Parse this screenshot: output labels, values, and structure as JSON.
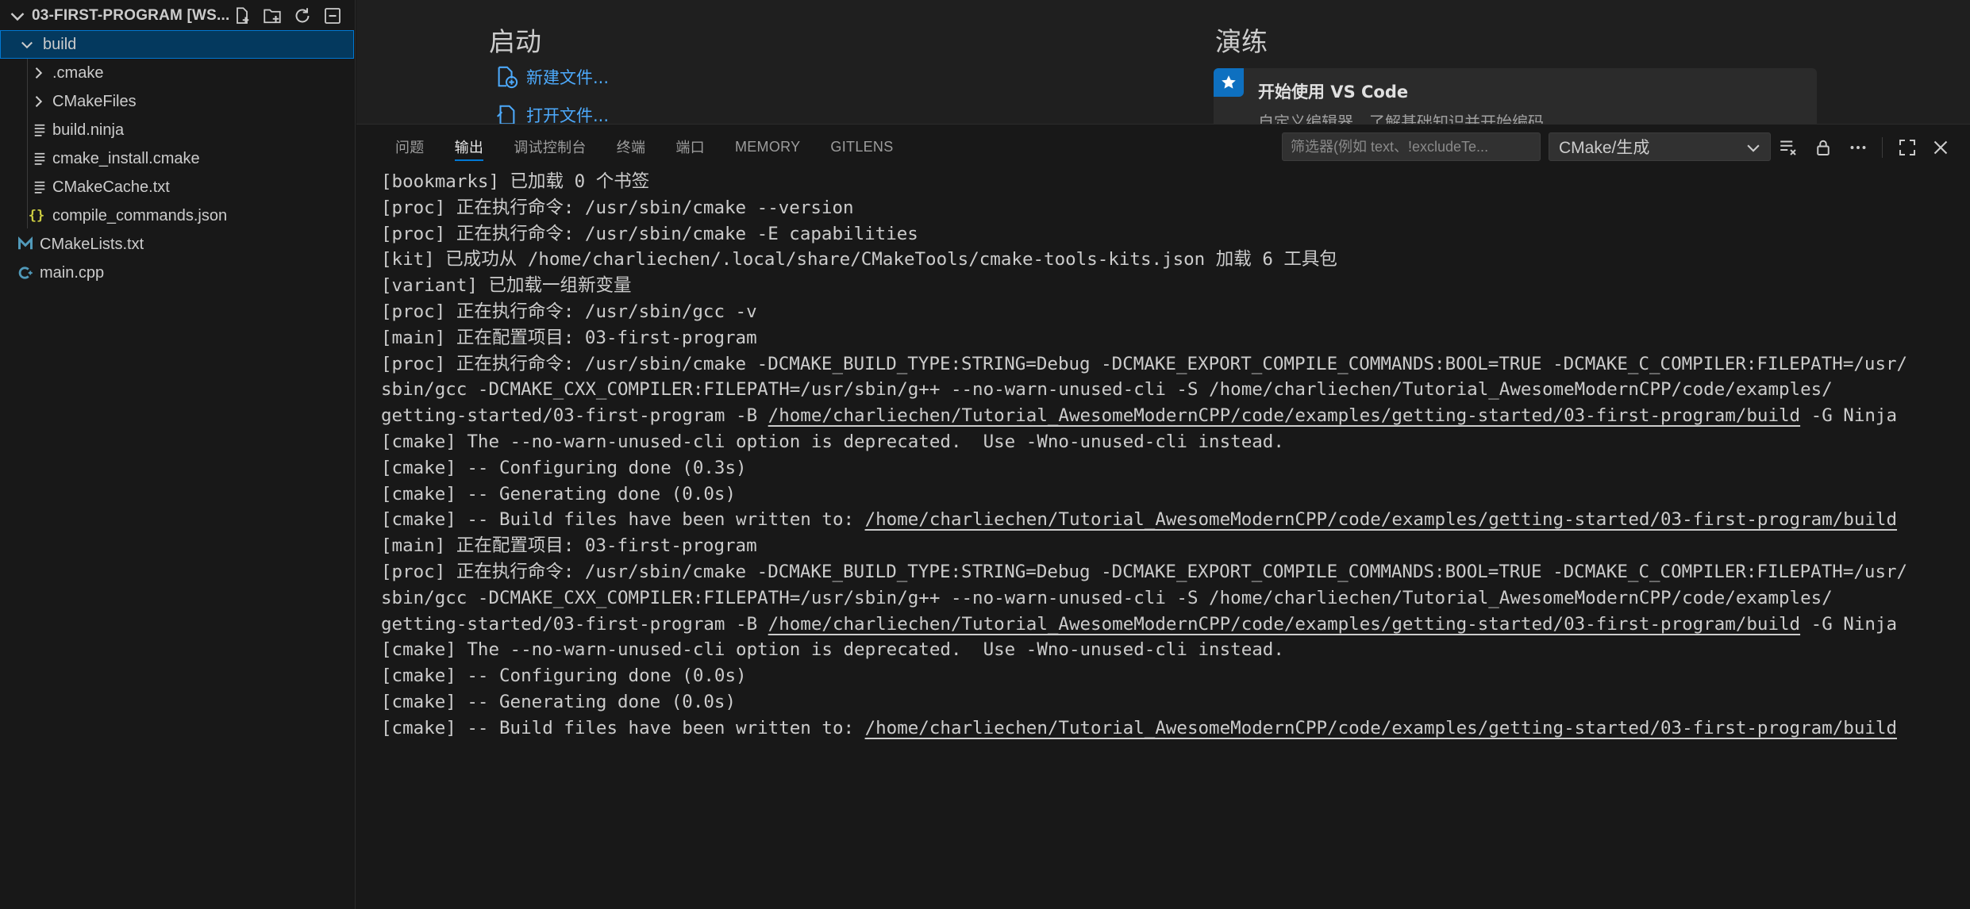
{
  "explorer": {
    "title": "03-FIRST-PROGRAM [WS...",
    "actions": [
      "new-file-icon",
      "new-folder-icon",
      "refresh-icon",
      "collapse-all-icon"
    ],
    "tree": [
      {
        "label": "build",
        "type": "folder-open",
        "selected": true
      },
      {
        "label": ".cmake",
        "type": "folder"
      },
      {
        "label": "CMakeFiles",
        "type": "folder"
      },
      {
        "label": "build.ninja",
        "type": "file-lines"
      },
      {
        "label": "cmake_install.cmake",
        "type": "file-lines"
      },
      {
        "label": "CMakeCache.txt",
        "type": "file-lines"
      },
      {
        "label": "compile_commands.json",
        "type": "json"
      },
      {
        "label": "CMakeLists.txt",
        "type": "cmake"
      },
      {
        "label": "main.cpp",
        "type": "cpp"
      }
    ]
  },
  "welcome": {
    "start_heading": "启动",
    "new_file": "新建文件...",
    "open_file": "打开文件...",
    "walkthrough_heading": "演练",
    "walkthrough_title": "开始使用 VS Code",
    "walkthrough_desc": "自定义编辑器、了解基础知识并开始编码"
  },
  "panel": {
    "tabs": [
      "问题",
      "输出",
      "调试控制台",
      "终端",
      "端口",
      "MEMORY",
      "GITLENS"
    ],
    "active_tab": "输出",
    "filter_placeholder": "筛选器(例如 text、!excludeTe...",
    "channel": "CMake/生成",
    "accent": "#0078d4"
  },
  "output_lines": [
    [
      "[bookmarks] 已加载 0 个书签"
    ],
    [
      "[proc] 正在执行命令: /usr/sbin/cmake --version"
    ],
    [
      "[proc] 正在执行命令: /usr/sbin/cmake -E capabilities"
    ],
    [
      "[kit] 已成功从 /home/charliechen/.local/share/CMakeTools/cmake-tools-kits.json 加载 6 工具包"
    ],
    [
      "[variant] 已加载一组新变量"
    ],
    [
      "[proc] 正在执行命令: /usr/sbin/gcc -v"
    ],
    [
      "[main] 正在配置项目: 03-first-program"
    ],
    [
      "[proc] 正在执行命令: /usr/sbin/cmake -DCMAKE_BUILD_TYPE:STRING=Debug -DCMAKE_EXPORT_COMPILE_COMMANDS:BOOL=TRUE -DCMAKE_C_COMPILER:FILEPATH=/usr/"
    ],
    [
      "sbin/gcc -DCMAKE_CXX_COMPILER:FILEPATH=/usr/sbin/g++ --no-warn-unused-cli -S /home/charliechen/Tutorial_AwesomeModernCPP/code/examples/"
    ],
    [
      "getting-started/03-first-program -B ",
      {
        "link": "/home/charliechen/Tutorial_AwesomeModernCPP/code/examples/getting-started/03-first-program/build"
      },
      " -G Ninja"
    ],
    [
      "[cmake] The --no-warn-unused-cli option is deprecated.  Use -Wno-unused-cli instead."
    ],
    [
      "[cmake] -- Configuring done (0.3s)"
    ],
    [
      "[cmake] -- Generating done (0.0s)"
    ],
    [
      "[cmake] -- Build files have been written to: ",
      {
        "link": "/home/charliechen/Tutorial_AwesomeModernCPP/code/examples/getting-started/03-first-program/build"
      }
    ],
    [
      "[main] 正在配置项目: 03-first-program"
    ],
    [
      "[proc] 正在执行命令: /usr/sbin/cmake -DCMAKE_BUILD_TYPE:STRING=Debug -DCMAKE_EXPORT_COMPILE_COMMANDS:BOOL=TRUE -DCMAKE_C_COMPILER:FILEPATH=/usr/"
    ],
    [
      "sbin/gcc -DCMAKE_CXX_COMPILER:FILEPATH=/usr/sbin/g++ --no-warn-unused-cli -S /home/charliechen/Tutorial_AwesomeModernCPP/code/examples/"
    ],
    [
      "getting-started/03-first-program -B ",
      {
        "link": "/home/charliechen/Tutorial_AwesomeModernCPP/code/examples/getting-started/03-first-program/build"
      },
      " -G Ninja"
    ],
    [
      "[cmake] The --no-warn-unused-cli option is deprecated.  Use -Wno-unused-cli instead."
    ],
    [
      "[cmake] -- Configuring done (0.0s)"
    ],
    [
      "[cmake] -- Generating done (0.0s)"
    ],
    [
      "[cmake] -- Build files have been written to: ",
      {
        "link": "/home/charliechen/Tutorial_AwesomeModernCPP/code/examples/getting-started/03-first-program/build"
      }
    ]
  ]
}
